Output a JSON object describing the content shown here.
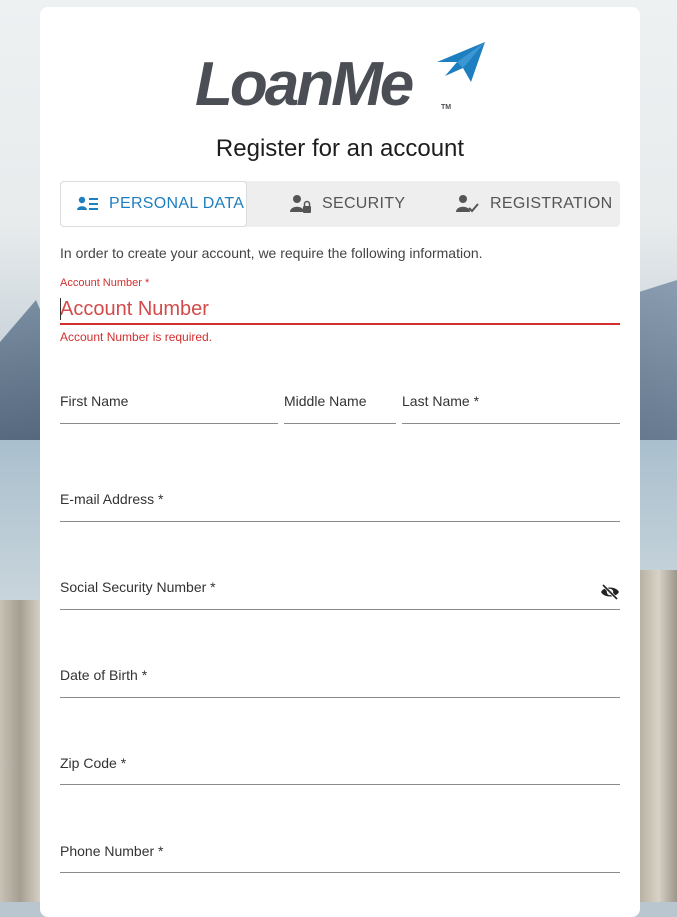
{
  "brand": {
    "name": "LoanMe",
    "trademark": "TM",
    "accent_color": "#1e7fc0",
    "text_color": "#4b4f55"
  },
  "page_title": "Register for an account",
  "tabs": [
    {
      "label": "PERSONAL DATA",
      "icon": "user-list-icon",
      "active": true
    },
    {
      "label": "SECURITY",
      "icon": "user-lock-icon",
      "active": false
    },
    {
      "label": "REGISTRATION",
      "icon": "user-check-icon",
      "active": false
    }
  ],
  "intro": "In order to create your account, we require the following information.",
  "account_number": {
    "label": "Account Number *",
    "placeholder": "Account Number",
    "value": "",
    "error": "Account Number is required.",
    "error_color": "#d32f2f"
  },
  "fields": {
    "first_name": "First Name",
    "middle_name": "Middle Name",
    "last_name": "Last Name *",
    "email": "E-mail Address *",
    "ssn": "Social Security Number *",
    "dob": "Date of Birth *",
    "zip": "Zip Code *",
    "phone": "Phone Number *"
  }
}
